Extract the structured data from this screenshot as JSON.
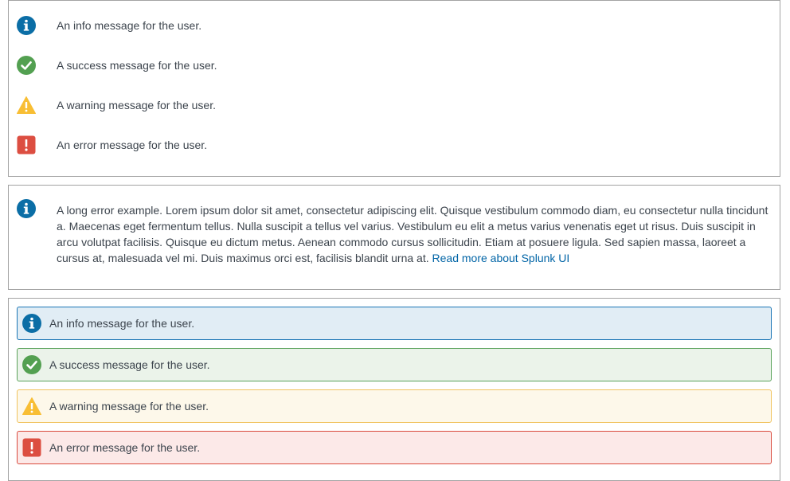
{
  "simple_messages": [
    {
      "type": "info",
      "icon": "info-icon",
      "text": "An info message for the user."
    },
    {
      "type": "success",
      "icon": "check-circle-icon",
      "text": "A success message for the user."
    },
    {
      "type": "warning",
      "icon": "warning-triangle-icon",
      "text": "A warning message for the user."
    },
    {
      "type": "error",
      "icon": "error-square-icon",
      "text": "An error message for the user."
    }
  ],
  "long_message": {
    "icon": "info-icon",
    "text": "A long error example. Lorem ipsum dolor sit amet, consectetur adipiscing elit. Quisque vestibulum commodo diam, eu consectetur nulla tincidunt a. Maecenas eget fermentum tellus. Nulla suscipit a tellus vel varius. Vestibulum eu elit a metus varius venenatis eget ut risus. Duis suscipit in arcu volutpat facilisis. Quisque eu dictum metus. Aenean commodo cursus sollicitudin. Etiam at posuere ligula. Sed sapien massa, laoreet a cursus at, malesuada vel mi. Duis maximus orci est, facilisis blandit urna at.",
    "link_text": "Read more about Splunk UI"
  },
  "boxed_messages": [
    {
      "type": "info",
      "icon": "info-icon",
      "text": "An info message for the user."
    },
    {
      "type": "success",
      "icon": "check-circle-icon",
      "text": "A success message for the user."
    },
    {
      "type": "warning",
      "icon": "warning-triangle-icon",
      "text": "A warning message for the user."
    },
    {
      "type": "error",
      "icon": "error-square-icon",
      "text": "An error message for the user."
    }
  ],
  "colors": {
    "info": "#0b6ea6",
    "success": "#53a051",
    "warning": "#f8be34",
    "error": "#dc4e41",
    "link": "#0064a6"
  }
}
